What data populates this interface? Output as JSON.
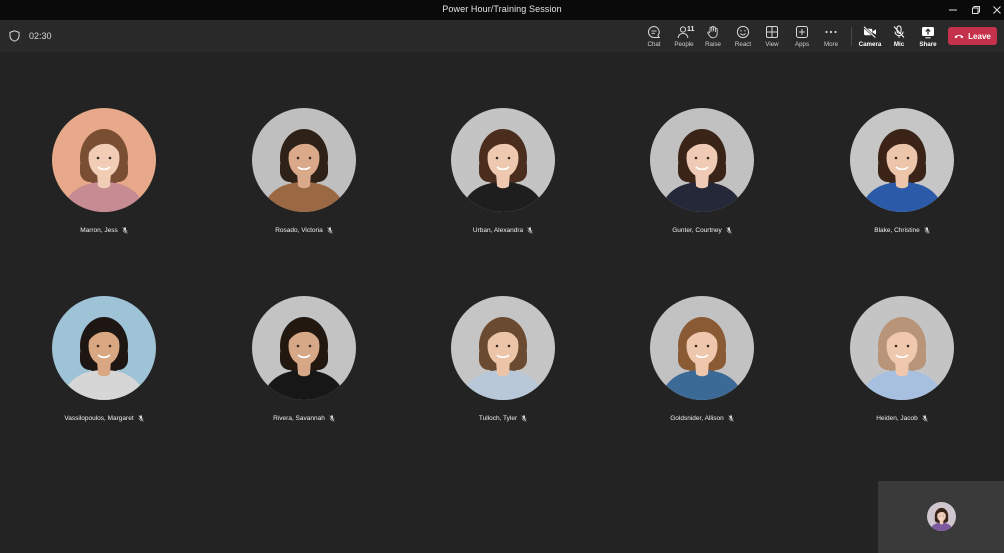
{
  "window": {
    "title": "Power Hour/Training Session"
  },
  "toolbar": {
    "timer": "02:30",
    "people_count": "11",
    "buttons": [
      {
        "id": "chat",
        "label": "Chat",
        "icon": "chat-icon"
      },
      {
        "id": "people",
        "label": "People",
        "icon": "people-icon"
      },
      {
        "id": "raise",
        "label": "Raise",
        "icon": "hand-icon"
      },
      {
        "id": "react",
        "label": "React",
        "icon": "emoji-icon"
      },
      {
        "id": "view",
        "label": "View",
        "icon": "grid-icon"
      },
      {
        "id": "apps",
        "label": "Apps",
        "icon": "apps-icon"
      },
      {
        "id": "more",
        "label": "More",
        "icon": "more-icon"
      },
      {
        "id": "camera",
        "label": "Camera",
        "icon": "camera-off-icon"
      },
      {
        "id": "mic",
        "label": "Mic",
        "icon": "mic-off-icon"
      },
      {
        "id": "share",
        "label": "Share",
        "icon": "share-icon"
      }
    ],
    "leave_label": "Leave"
  },
  "colors": {
    "background": "#232323",
    "titlebar": "#0a0a0a",
    "toolbar": "#292929",
    "leave": "#c4314b",
    "self_view": "#3a3a3a"
  },
  "participants": [
    {
      "name": "Marron, Jess",
      "muted": true,
      "bg": "#e8a98a",
      "skin": "#f0cdb4",
      "hair": "#7a4e32",
      "shirt": "#c78c93"
    },
    {
      "name": "Rosado, Victoria",
      "muted": true,
      "bg": "#bfbfbf",
      "skin": "#d9a98a",
      "hair": "#2e2118",
      "shirt": "#9a6842"
    },
    {
      "name": "Urban, Alexandra",
      "muted": true,
      "bg": "#c4c4c4",
      "skin": "#eec9b0",
      "hair": "#4a2d1c",
      "shirt": "#1e1e1e"
    },
    {
      "name": "Gunter, Courtney",
      "muted": true,
      "bg": "#c1c1c1",
      "skin": "#efcbb5",
      "hair": "#3a2418",
      "shirt": "#242838"
    },
    {
      "name": "Blake, Christine",
      "muted": true,
      "bg": "#c6c6c6",
      "skin": "#ecc5ab",
      "hair": "#3b2417",
      "shirt": "#2a5aa8"
    },
    {
      "name": "Vassilopoulos, Margaret",
      "muted": true,
      "bg": "#9fc3d6",
      "skin": "#d9a781",
      "hair": "#1e1612",
      "shirt": "#d6d6d6"
    },
    {
      "name": "Rivera, Savannah",
      "muted": true,
      "bg": "#c3c3c3",
      "skin": "#d7a888",
      "hair": "#23180f",
      "shirt": "#171717"
    },
    {
      "name": "Tulloch, Tyler",
      "muted": true,
      "bg": "#c5c5c5",
      "skin": "#ecc4a8",
      "hair": "#6a4a30",
      "shirt": "#b9c8d8"
    },
    {
      "name": "Goldsnider, Allison",
      "muted": true,
      "bg": "#c2c2c2",
      "skin": "#efc7ac",
      "hair": "#8a5a34",
      "shirt": "#3c6a96"
    },
    {
      "name": "Heiden, Jacob",
      "muted": true,
      "bg": "#c4c4c4",
      "skin": "#efc8ae",
      "hair": "#b89478",
      "shirt": "#a8c0e0"
    }
  ],
  "self_view": {
    "bg": "#d0c6cf",
    "skin": "#efcdb8",
    "hair": "#3a2418",
    "shirt": "#7d5a9e"
  }
}
